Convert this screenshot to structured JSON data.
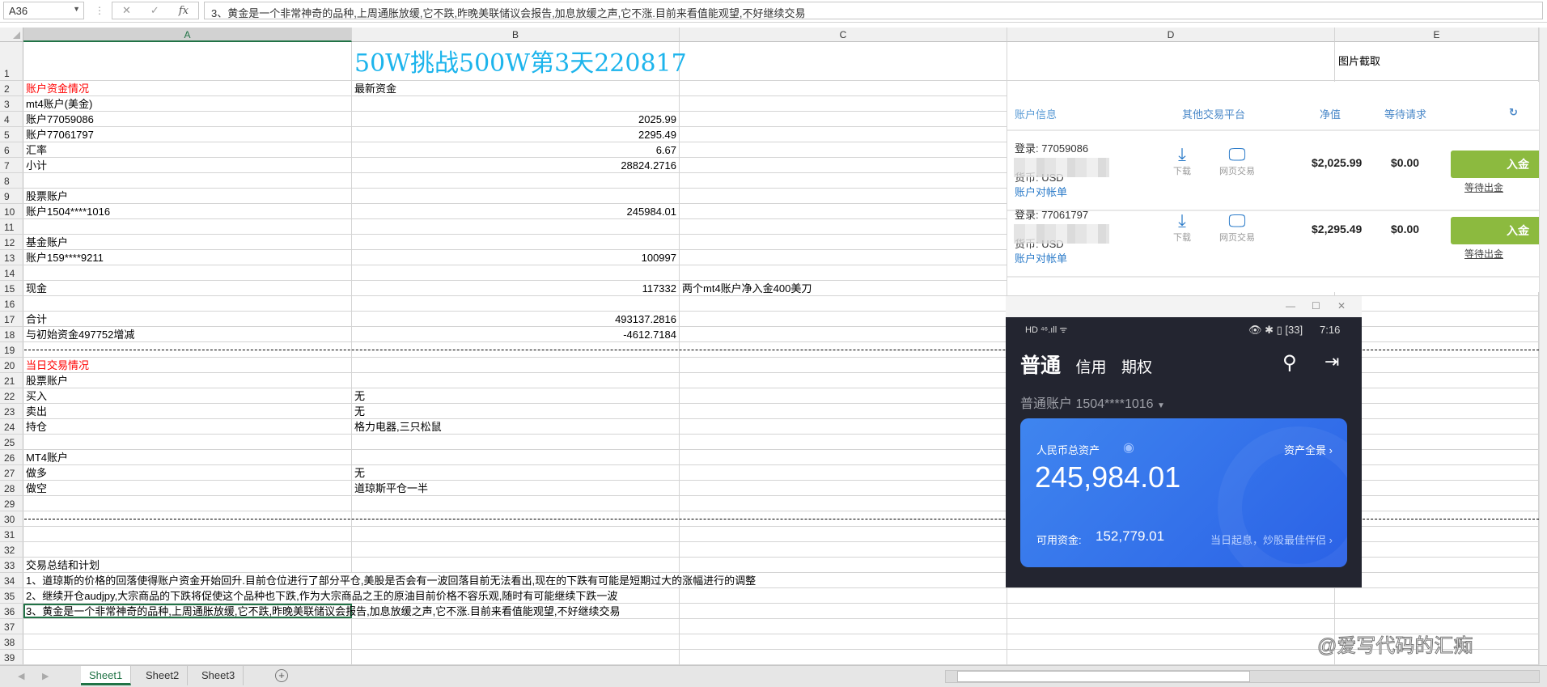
{
  "formula_bar": {
    "cell_ref": "A36",
    "cancel": "✕",
    "confirm": "✓",
    "fx": "fx",
    "content": "3、黄金是一个非常神奇的品种,上周通胀放缓,它不跌,昨晚美联储议会报告,加息放缓之声,它不涨.目前来看值能观望,不好继续交易"
  },
  "columns": [
    "A",
    "B",
    "C",
    "D",
    "E"
  ],
  "rows": [
    {
      "n": "1",
      "a": "",
      "b": "50W挑战500W第3天220817",
      "c": "",
      "e": "图片截取",
      "style": "title"
    },
    {
      "n": "2",
      "a": "账户资金情况",
      "b": "最新资金",
      "c": "",
      "style": "redA"
    },
    {
      "n": "3",
      "a": "mt4账户(美金)",
      "b": "",
      "c": ""
    },
    {
      "n": "4",
      "a": "账户77059086",
      "b": "2025.99",
      "c": "",
      "num": true
    },
    {
      "n": "5",
      "a": "账户77061797",
      "b": "2295.49",
      "c": "",
      "num": true
    },
    {
      "n": "6",
      "a": "汇率",
      "b": "6.67",
      "c": "",
      "num": true
    },
    {
      "n": "7",
      "a": "小计",
      "b": "28824.2716",
      "c": "",
      "num": true
    },
    {
      "n": "8",
      "a": "",
      "b": "",
      "c": ""
    },
    {
      "n": "9",
      "a": "股票账户",
      "b": "",
      "c": ""
    },
    {
      "n": "10",
      "a": "账户1504****1016",
      "b": "245984.01",
      "c": "",
      "num": true
    },
    {
      "n": "11",
      "a": "",
      "b": "",
      "c": ""
    },
    {
      "n": "12",
      "a": "基金账户",
      "b": "",
      "c": ""
    },
    {
      "n": "13",
      "a": "账户159****9211",
      "b": "100997",
      "c": "",
      "num": true
    },
    {
      "n": "14",
      "a": "",
      "b": "",
      "c": ""
    },
    {
      "n": "15",
      "a": "现金",
      "b": "117332",
      "c": "两个mt4账户净入金400美刀",
      "num": true
    },
    {
      "n": "16",
      "a": "",
      "b": "",
      "c": ""
    },
    {
      "n": "17",
      "a": "合计",
      "b": "493137.2816",
      "c": "",
      "num": true
    },
    {
      "n": "18",
      "a": "与初始资金497752增减",
      "b": "-4612.7184",
      "c": "",
      "num": true
    },
    {
      "n": "19",
      "a": "",
      "b": "",
      "c": "",
      "style": "dash"
    },
    {
      "n": "20",
      "a": "当日交易情况",
      "b": "",
      "c": "",
      "style": "redA"
    },
    {
      "n": "21",
      "a": "股票账户",
      "b": "",
      "c": ""
    },
    {
      "n": "22",
      "a": "买入",
      "b": "无",
      "c": ""
    },
    {
      "n": "23",
      "a": "卖出",
      "b": "无",
      "c": ""
    },
    {
      "n": "24",
      "a": "持仓",
      "b": "格力电器,三只松鼠",
      "c": ""
    },
    {
      "n": "25",
      "a": "",
      "b": "",
      "c": ""
    },
    {
      "n": "26",
      "a": "MT4账户",
      "b": "",
      "c": ""
    },
    {
      "n": "27",
      "a": "做多",
      "b": "无",
      "c": ""
    },
    {
      "n": "28",
      "a": "做空",
      "b": "道琼斯平仓一半",
      "c": ""
    },
    {
      "n": "29",
      "a": "",
      "b": "",
      "c": ""
    },
    {
      "n": "30",
      "a": "",
      "b": "",
      "c": "",
      "style": "dash"
    },
    {
      "n": "31",
      "a": "",
      "b": "",
      "c": ""
    },
    {
      "n": "32",
      "a": "",
      "b": "",
      "c": ""
    },
    {
      "n": "33",
      "a": "交易总结和计划",
      "b": "",
      "c": ""
    },
    {
      "n": "34",
      "a": "1、道琼斯的价格的回落使得账户资金开始回升.目前仓位进行了部分平仓,美股是否会有一波回落目前无法看出,现在的下跌有可能是短期过大的涨幅进行的调整",
      "b": "",
      "c": "",
      "style": "over"
    },
    {
      "n": "35",
      "a": "2、继续开仓audjpy,大宗商品的下跌将促使这个品种也下跌,作为大宗商品之王的原油目前价格不容乐观,随时有可能继续下跌一波",
      "b": "",
      "c": "",
      "style": "over"
    },
    {
      "n": "36",
      "a": "3、黄金是一个非常神奇的品种,上周通胀放缓,它不跌,昨晚美联储议会报告,加息放缓之声,它不涨.目前来看值能观望,不好继续交易",
      "b": "",
      "c": "",
      "style": "over",
      "selected": true
    },
    {
      "n": "37",
      "a": "",
      "b": "",
      "c": ""
    },
    {
      "n": "38",
      "a": "",
      "b": "",
      "c": ""
    },
    {
      "n": "39",
      "a": "",
      "b": "",
      "c": ""
    }
  ],
  "mt4": {
    "headers": [
      "账户信息",
      "其他交易平台",
      "净值",
      "等待请求"
    ],
    "accounts": [
      {
        "login": "登录: 77059086",
        "currency": "货币: USD",
        "statement": "账户对帐单",
        "equity": "$2,025.99",
        "pending": "$0.00"
      },
      {
        "login": "登录: 77061797",
        "currency": "货币: USD",
        "statement": "账户对帐单",
        "equity": "$2,295.49",
        "pending": "$0.00"
      }
    ],
    "download": "下载",
    "web_trade": "网页交易",
    "deposit": "入金",
    "withdraw_wait": "等待出金"
  },
  "phone": {
    "status_left": "HD ⁴⁶.ıll ᯤ",
    "time": "7:16",
    "battery": "33",
    "tabs": [
      "普通",
      "信用",
      "期权"
    ],
    "account": "普通账户 1504****1016",
    "card": {
      "label": "人民币总资产",
      "overview": "资产全景",
      "total": "245,984.01",
      "available_label": "可用资金:",
      "available": "152,779.01",
      "promo": "当日起息，炒股最佳伴侣"
    }
  },
  "sheets": [
    "Sheet1",
    "Sheet2",
    "Sheet3"
  ],
  "add_sheet": "+",
  "watermark": "@爱写代码的汇痴"
}
